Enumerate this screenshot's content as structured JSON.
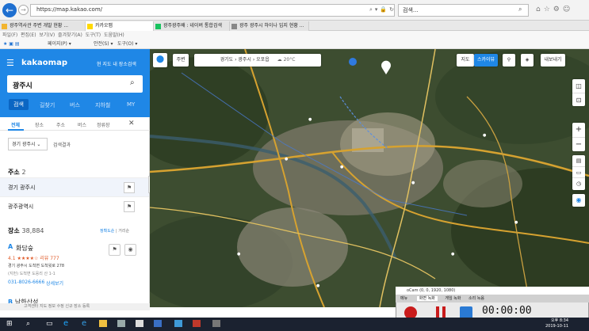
{
  "browser": {
    "url": "https://map.kakao.com/",
    "search_placeholder": "검색...",
    "tabs": [
      {
        "label": "광주역사관 주변 개발 현황 ...",
        "color": "#f2b530"
      },
      {
        "label": "카카오맵",
        "color": "#ffd900"
      },
      {
        "label": "광주광주배 : 네이버 통합검색",
        "color": "#19c35f"
      },
      {
        "label": "광주 광주시 하이나 입지 현황 ...",
        "color": "#888888"
      }
    ],
    "menu": [
      "파일(F)",
      "편집(E)",
      "보기(V)",
      "즐겨찾기(A)",
      "도구(T)",
      "도움말(H)"
    ],
    "favbar": [
      "페이지(P) ▾",
      "안전(S) ▾",
      "도구(O) ▾"
    ]
  },
  "kakao": {
    "logo": "kakaomap",
    "promo": "현 지도 내 장소검색",
    "search_value": "광주시",
    "tabs": [
      "검색",
      "길찾기",
      "버스",
      "지하철",
      "MY"
    ],
    "filters": [
      "전체",
      "장소",
      "주소",
      "버스",
      "정류장"
    ],
    "region_select": "경기 광주시",
    "region_result": "검색결과",
    "address_header": "주소",
    "address_count": "2",
    "addresses": [
      "경기 광주시",
      "광주광역시"
    ],
    "place_header": "장소",
    "place_count": "38,884",
    "place_sort": "정확도순",
    "place_sort_alt": "거리순",
    "place": {
      "letter": "A",
      "name": "화담숲",
      "rating": "4.1 ★★★★☆ 리뷰 777",
      "addr1": "경기 광주시 도척면 도척윗로 278",
      "addr2": "(지번) 도척면 도웅리 산 1-1",
      "tel": "031-8026-6666",
      "detail": "상세보기"
    },
    "place_b_letter": "B",
    "place_b_name": "남한산성",
    "footer": "고객센터   지도 정보 수정   신규 장소 등록"
  },
  "map": {
    "top_button": "주변",
    "breadcrumb": "경기도 › 광주시 › 오포읍",
    "weather": "20°C",
    "view_map": "지도",
    "view_sky": "스카이뷰",
    "share": "내보내기",
    "marker_label": "1"
  },
  "recorder": {
    "title": "oCam (0, 0, 1920, 1080)",
    "tabs": [
      "메뉴",
      "화면 녹화",
      "게임 녹화",
      "소리 녹음"
    ],
    "time": "00:00:00"
  },
  "taskbar": {
    "time": "오후 8:34",
    "date": "2019-10-11"
  }
}
